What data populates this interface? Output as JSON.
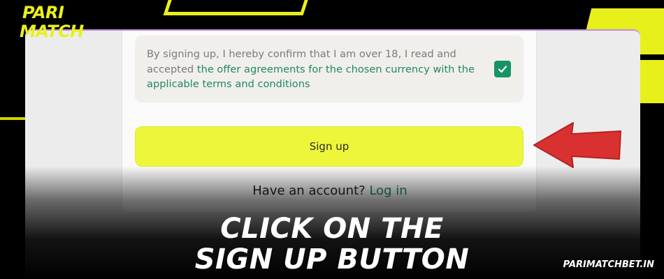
{
  "brand": {
    "logo_line1": "PARI",
    "logo_line2": "MATCH",
    "accent_color": "#e8f01c"
  },
  "form": {
    "consent_text_plain": "By signing up, I hereby confirm that I am over 18, I read and accepted ",
    "consent_link_text": "the offer agreements for the chosen currency with the applicable terms and conditions",
    "consent_checked": true,
    "checkbox_color": "#179463",
    "signup_label": "Sign up",
    "signup_color": "#eef63c",
    "have_account_text": "Have an account?",
    "login_label": "Log in",
    "link_color": "#1f8a5a"
  },
  "annotation": {
    "arrow_color": "#d8312f",
    "arrow_icon": "arrow-left-icon"
  },
  "caption": {
    "line1": "CLICK ON THE",
    "line2": "SIGN UP BUTTON",
    "site": "PARIMATCHBET.IN"
  }
}
